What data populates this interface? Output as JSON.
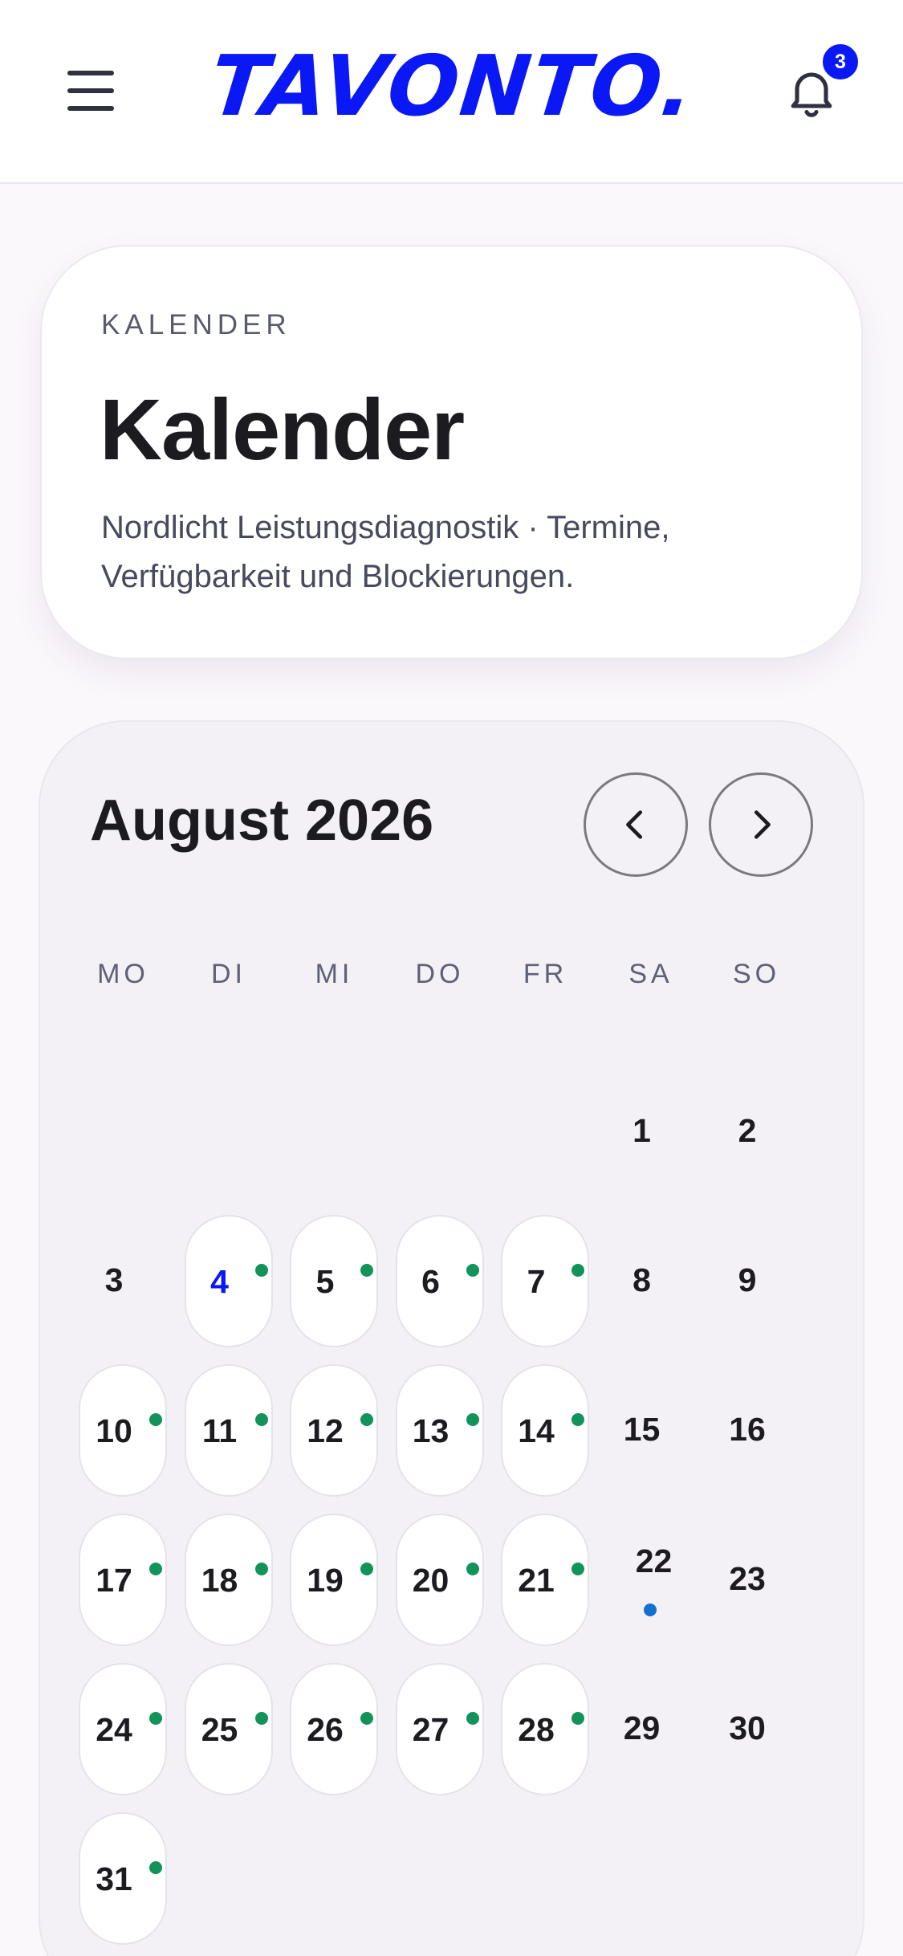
{
  "header": {
    "logo_text": "TAVONTO.",
    "notification_count": "3",
    "brand_color": "#0a18f5"
  },
  "hero": {
    "eyebrow": "KALENDER",
    "title": "Kalender",
    "subtitle": "Nordlicht Leistungsdiagnostik · Termine, Verfügbarkeit und Blockierungen."
  },
  "calendar": {
    "month_label": "August 2026",
    "weekdays": [
      "MO",
      "DI",
      "MI",
      "DO",
      "FR",
      "SA",
      "SO"
    ],
    "today": 4,
    "days": [
      {
        "n": "1",
        "type": "plain"
      },
      {
        "n": "2",
        "type": "plain"
      },
      {
        "n": "3",
        "type": "plain"
      },
      {
        "n": "4",
        "type": "workday",
        "today": true,
        "dot": "green"
      },
      {
        "n": "5",
        "type": "workday",
        "dot": "green"
      },
      {
        "n": "6",
        "type": "workday",
        "dot": "green"
      },
      {
        "n": "7",
        "type": "workday",
        "dot": "green"
      },
      {
        "n": "8",
        "type": "plain"
      },
      {
        "n": "9",
        "type": "plain"
      },
      {
        "n": "10",
        "type": "workday",
        "dot": "green"
      },
      {
        "n": "11",
        "type": "workday",
        "dot": "green"
      },
      {
        "n": "12",
        "type": "workday",
        "dot": "green"
      },
      {
        "n": "13",
        "type": "workday",
        "dot": "green"
      },
      {
        "n": "14",
        "type": "workday",
        "dot": "green"
      },
      {
        "n": "15",
        "type": "plain"
      },
      {
        "n": "16",
        "type": "plain"
      },
      {
        "n": "17",
        "type": "workday",
        "dot": "green"
      },
      {
        "n": "18",
        "type": "workday",
        "dot": "green"
      },
      {
        "n": "19",
        "type": "workday",
        "dot": "green"
      },
      {
        "n": "20",
        "type": "workday",
        "dot": "green"
      },
      {
        "n": "21",
        "type": "workday",
        "dot": "green"
      },
      {
        "n": "22",
        "type": "plain",
        "dot": "blue"
      },
      {
        "n": "23",
        "type": "plain"
      },
      {
        "n": "24",
        "type": "workday",
        "dot": "green"
      },
      {
        "n": "25",
        "type": "workday",
        "dot": "green"
      },
      {
        "n": "26",
        "type": "workday",
        "dot": "green"
      },
      {
        "n": "27",
        "type": "workday",
        "dot": "green"
      },
      {
        "n": "28",
        "type": "workday",
        "dot": "green"
      },
      {
        "n": "29",
        "type": "plain"
      },
      {
        "n": "30",
        "type": "plain"
      },
      {
        "n": "31",
        "type": "workday",
        "dot": "green"
      }
    ],
    "dot_colors": {
      "green": "#12935a",
      "blue": "#1271cf"
    }
  }
}
